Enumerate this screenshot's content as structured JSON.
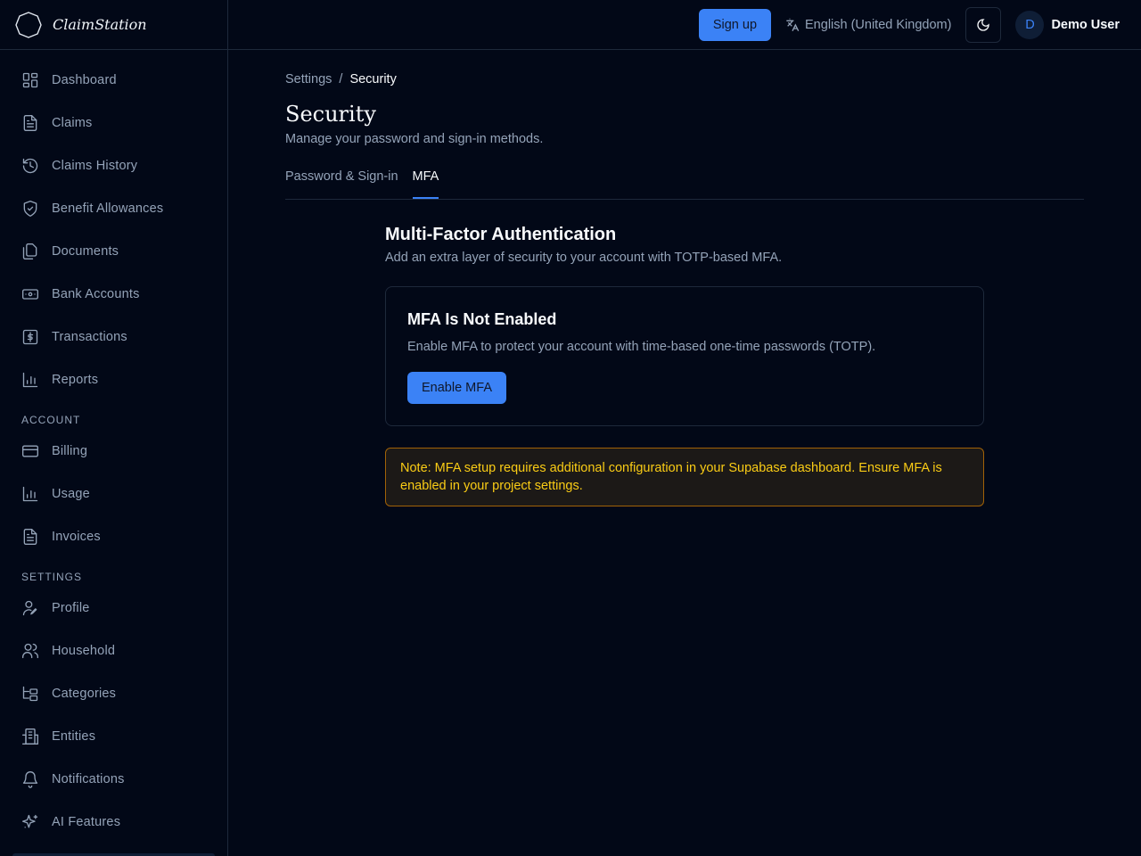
{
  "app": {
    "name": "ClaimStation"
  },
  "sidebar": {
    "main": [
      {
        "label": "Dashboard",
        "icon": "dashboard-icon"
      },
      {
        "label": "Claims",
        "icon": "file-icon"
      },
      {
        "label": "Claims History",
        "icon": "history-icon"
      },
      {
        "label": "Benefit Allowances",
        "icon": "shield-icon"
      },
      {
        "label": "Documents",
        "icon": "documents-icon"
      },
      {
        "label": "Bank Accounts",
        "icon": "banknote-icon"
      },
      {
        "label": "Transactions",
        "icon": "dollar-icon"
      },
      {
        "label": "Reports",
        "icon": "chart-icon"
      }
    ],
    "account_label": "ACCOUNT",
    "account": [
      {
        "label": "Billing",
        "icon": "credit-card-icon"
      },
      {
        "label": "Usage",
        "icon": "chart-icon"
      },
      {
        "label": "Invoices",
        "icon": "file-icon"
      }
    ],
    "settings_label": "SETTINGS",
    "settings": [
      {
        "label": "Profile",
        "icon": "user-pen-icon"
      },
      {
        "label": "Household",
        "icon": "users-icon"
      },
      {
        "label": "Categories",
        "icon": "folder-tree-icon"
      },
      {
        "label": "Entities",
        "icon": "building-icon"
      },
      {
        "label": "Notifications",
        "icon": "bell-icon"
      },
      {
        "label": "AI Features",
        "icon": "sparkles-icon"
      }
    ]
  },
  "topbar": {
    "signup": "Sign up",
    "language": "English (United Kingdom)",
    "user_initial": "D",
    "user_name": "Demo User"
  },
  "breadcrumb": {
    "parent": "Settings",
    "separator": "/",
    "current": "Security"
  },
  "page": {
    "title": "Security",
    "subtitle": "Manage your password and sign-in methods."
  },
  "tabs": [
    {
      "label": "Password & Sign-in"
    },
    {
      "label": "MFA",
      "active": true
    }
  ],
  "mfa": {
    "title": "Multi-Factor Authentication",
    "subtitle": "Add an extra layer of security to your account with TOTP-based MFA.",
    "card_title": "MFA Is Not Enabled",
    "card_text": "Enable MFA to protect your account with time-based one-time passwords (TOTP).",
    "button": "Enable MFA",
    "note": "Note: MFA setup requires additional configuration in your Supabase dashboard. Ensure MFA is enabled in your project settings."
  },
  "colors": {
    "accent": "#3b82f6",
    "background": "#020817",
    "warning": "#facc15"
  }
}
